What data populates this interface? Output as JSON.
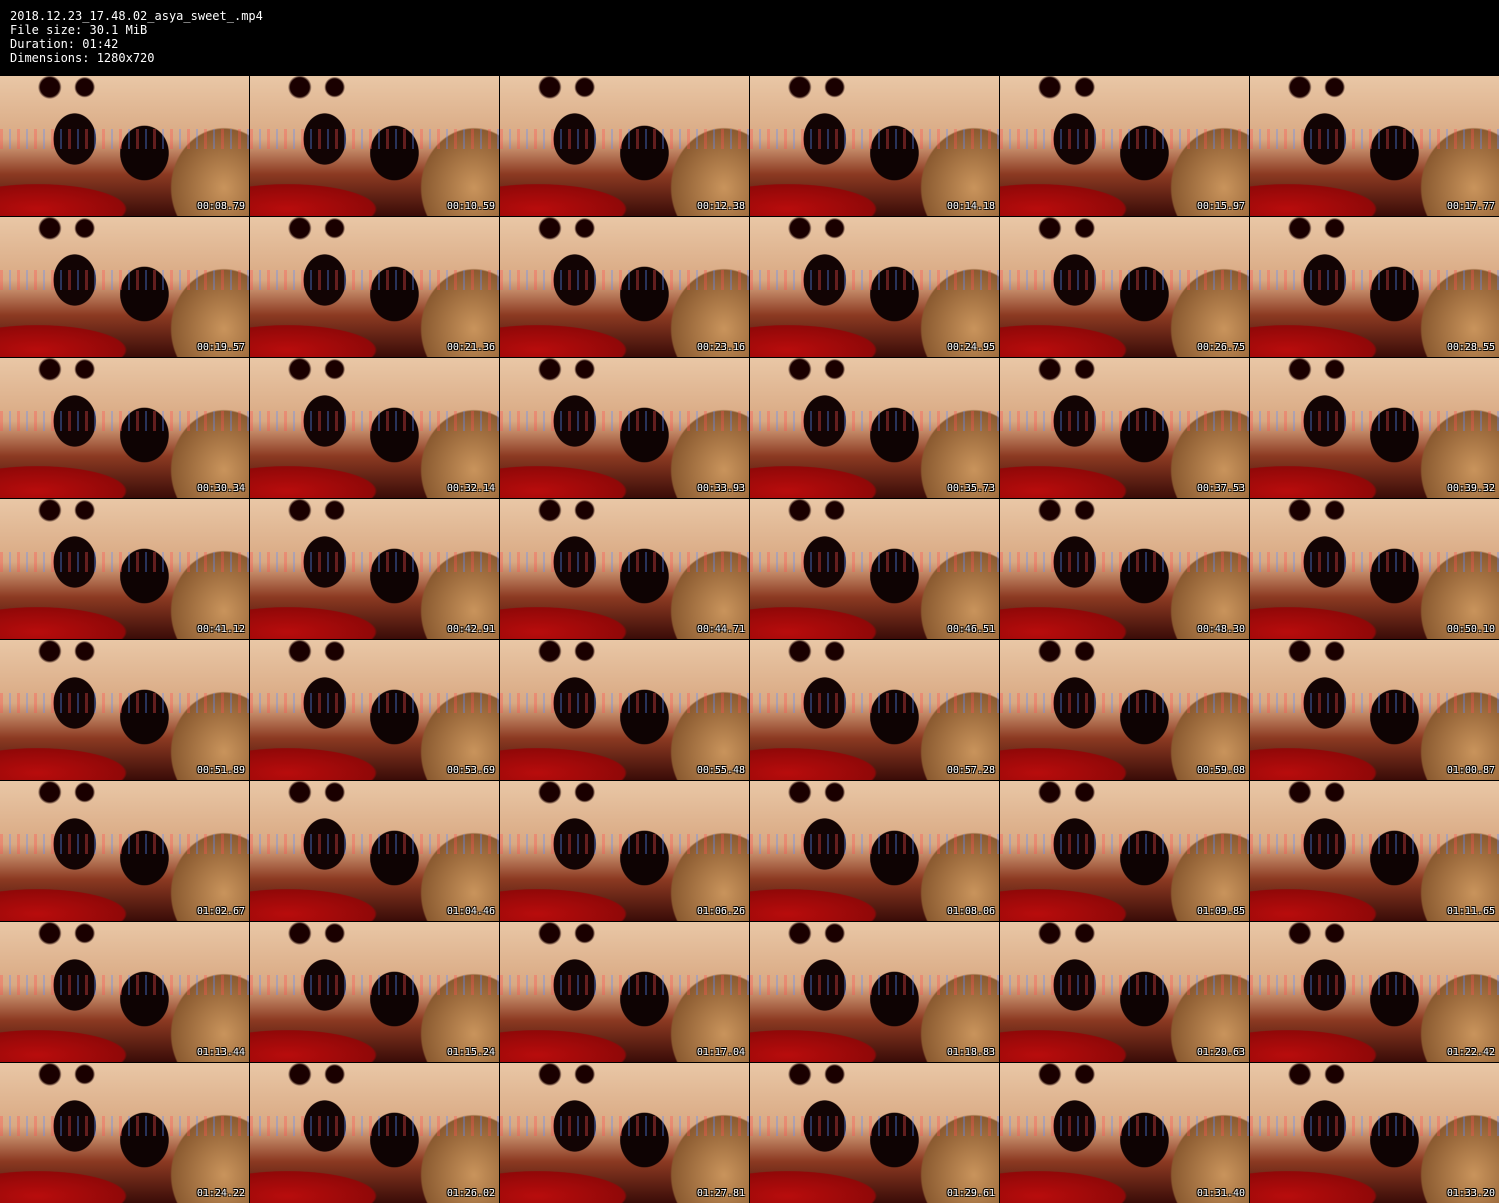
{
  "header": {
    "filename": "2018.12.23_17.48.02_asya_sweet_.mp4",
    "file_size": "File size: 30.1 MiB",
    "duration": "Duration: 01:42",
    "dimensions": "Dimensions: 1280x720"
  },
  "thumbnails": [
    {
      "timestamp": "00:08.79"
    },
    {
      "timestamp": "00:10.59"
    },
    {
      "timestamp": "00:12.38"
    },
    {
      "timestamp": "00:14.18"
    },
    {
      "timestamp": "00:15.97"
    },
    {
      "timestamp": "00:17.77"
    },
    {
      "timestamp": "00:19.57"
    },
    {
      "timestamp": "00:21.36"
    },
    {
      "timestamp": "00:23.16"
    },
    {
      "timestamp": "00:24.95"
    },
    {
      "timestamp": "00:26.75"
    },
    {
      "timestamp": "00:28.55"
    },
    {
      "timestamp": "00:30.34"
    },
    {
      "timestamp": "00:32.14"
    },
    {
      "timestamp": "00:33.93"
    },
    {
      "timestamp": "00:35.73"
    },
    {
      "timestamp": "00:37.53"
    },
    {
      "timestamp": "00:39.32"
    },
    {
      "timestamp": "00:41.12"
    },
    {
      "timestamp": "00:42.91"
    },
    {
      "timestamp": "00:44.71"
    },
    {
      "timestamp": "00:46.51"
    },
    {
      "timestamp": "00:48.30"
    },
    {
      "timestamp": "00:50.10"
    },
    {
      "timestamp": "00:51.89"
    },
    {
      "timestamp": "00:53.69"
    },
    {
      "timestamp": "00:55.48"
    },
    {
      "timestamp": "00:57.28"
    },
    {
      "timestamp": "00:59.08"
    },
    {
      "timestamp": "01:00.87"
    },
    {
      "timestamp": "01:02.67"
    },
    {
      "timestamp": "01:04.46"
    },
    {
      "timestamp": "01:06.26"
    },
    {
      "timestamp": "01:08.06"
    },
    {
      "timestamp": "01:09.85"
    },
    {
      "timestamp": "01:11.65"
    },
    {
      "timestamp": "01:13.44"
    },
    {
      "timestamp": "01:15.24"
    },
    {
      "timestamp": "01:17.04"
    },
    {
      "timestamp": "01:18.83"
    },
    {
      "timestamp": "01:20.63"
    },
    {
      "timestamp": "01:22.42"
    },
    {
      "timestamp": "01:24.22"
    },
    {
      "timestamp": "01:26.02"
    },
    {
      "timestamp": "01:27.81"
    },
    {
      "timestamp": "01:29.61"
    },
    {
      "timestamp": "01:31.40"
    },
    {
      "timestamp": "01:33.20"
    }
  ]
}
